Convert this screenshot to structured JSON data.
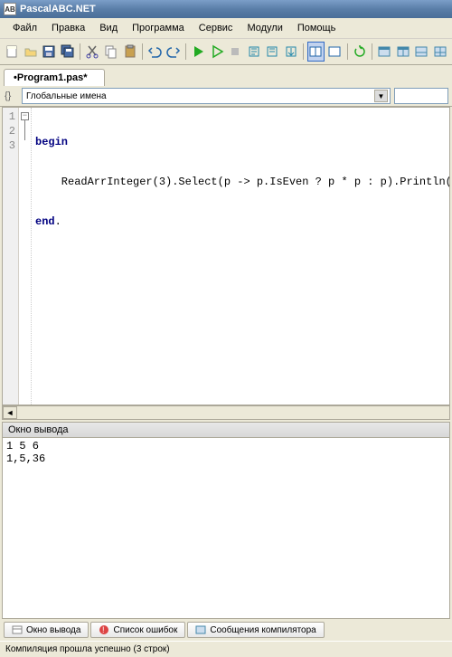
{
  "title": "PascalABC.NET",
  "menu": [
    "Файл",
    "Правка",
    "Вид",
    "Программа",
    "Сервис",
    "Модули",
    "Помощь"
  ],
  "toolbar_icons": [
    "new-file-icon",
    "open-file-icon",
    "save-icon",
    "save-all-icon",
    "sep",
    "cut-icon",
    "copy-icon",
    "paste-icon",
    "sep",
    "undo-icon",
    "redo-icon",
    "sep",
    "run-icon",
    "run2-icon",
    "stop-icon",
    "step-icon",
    "step-over-icon",
    "step-out-icon",
    "sep",
    "layout1-icon",
    "layout2-icon",
    "sep",
    "refresh-icon",
    "sep",
    "window1-icon",
    "window2-icon",
    "window3-icon",
    "window4-icon"
  ],
  "tab": {
    "label": "•Program1.pas*"
  },
  "nav": {
    "combo_label": "Глобальные имена"
  },
  "code": {
    "lines": [
      "1",
      "2",
      "3"
    ],
    "line1_kw": "begin",
    "line2_fn": "    ReadArrInteger",
    "line2_args": "(3).Select(p -> p.IsEven ? p * p : p).Println(",
    "line2_str": "','",
    "line2_end": ")",
    "line3_kw": "end",
    "line3_dot": "."
  },
  "output": {
    "title": "Окно вывода",
    "text": "1 5 6\n1,5,36"
  },
  "bottom_tabs": [
    {
      "label": "Окно вывода",
      "icon": "output-icon"
    },
    {
      "label": "Список ошибок",
      "icon": "errors-icon"
    },
    {
      "label": "Сообщения компилятора",
      "icon": "messages-icon"
    }
  ],
  "status": "Компиляция прошла успешно (3 строк)"
}
